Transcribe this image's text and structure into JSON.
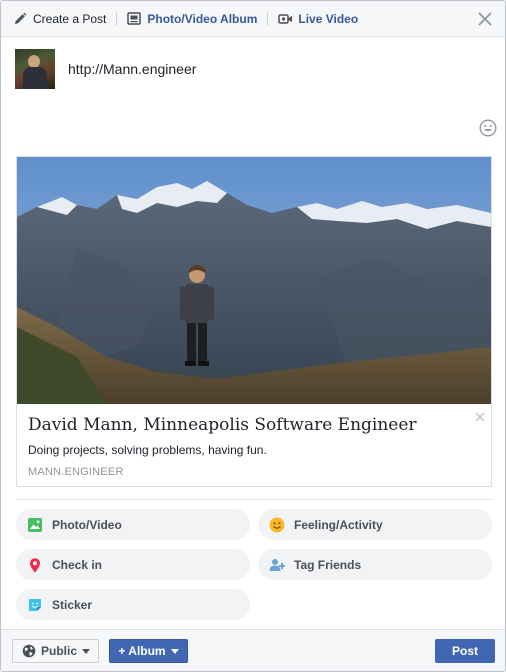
{
  "tabs": {
    "create_post": "Create a Post",
    "photo_video_album": "Photo/Video Album",
    "live_video": "Live Video"
  },
  "composer": {
    "text": "http://Mann.engineer"
  },
  "link_preview": {
    "title": "David Mann, Minneapolis Software Engineer",
    "description": "Doing projects, solving problems, having fun.",
    "domain": "MANN.ENGINEER"
  },
  "options": {
    "photo_video": "Photo/Video",
    "feeling_activity": "Feeling/Activity",
    "check_in": "Check in",
    "tag_friends": "Tag Friends",
    "sticker": "Sticker"
  },
  "footer": {
    "privacy": "Public",
    "album": "+ Album",
    "post": "Post"
  },
  "colors": {
    "brand_blue": "#4267b2",
    "link_blue": "#365899",
    "photo_green": "#45bd62",
    "feeling_yellow": "#f7b928",
    "checkin_red": "#f5533d",
    "tag_blue": "#1877f2",
    "sticker_teal": "#3ec4ea"
  }
}
